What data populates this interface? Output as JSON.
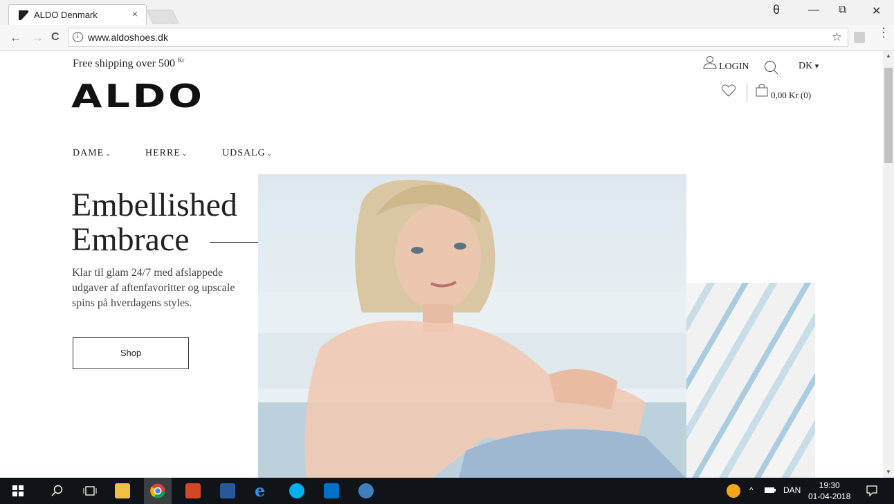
{
  "browser": {
    "tab_title": "ALDO Denmark",
    "tab_close": "×",
    "url": "www.aldoshoes.dk",
    "info_icon": "i",
    "star_icon": "☆",
    "back_icon": "←",
    "forward_icon": "→",
    "reload_icon": "C",
    "profile_icon": "θ",
    "minimize_icon": "—",
    "restore_icon": "⧉",
    "close_icon": "✕",
    "menu_icon": "⋮"
  },
  "header": {
    "promo_text": "Free shipping over 500",
    "promo_currency": "Kr",
    "logo": "ALDO",
    "login_label": "LOGIN",
    "country": "DK",
    "country_chevron": "▾",
    "cart_label": "0,00 Kr (0)"
  },
  "nav": {
    "items": [
      {
        "label": "DAME",
        "chevron": "⌄"
      },
      {
        "label": "HERRE",
        "chevron": "⌄"
      },
      {
        "label": "UDSALG",
        "chevron": "⌄"
      }
    ]
  },
  "hero": {
    "title_line1": "Embellished",
    "title_line2": "Embrace",
    "description": "Klar til glam 24/7 med afslappede udgaver af aftenfavoritter og upscale spins på hverdagens styles.",
    "shop_label": "Shop"
  },
  "taskbar": {
    "language": "DAN",
    "time": "19:30",
    "date": "01-04-2018",
    "tray_chevron": "^"
  },
  "colors": {
    "brand_black": "#111111",
    "taskbar_bg": "#101418"
  }
}
